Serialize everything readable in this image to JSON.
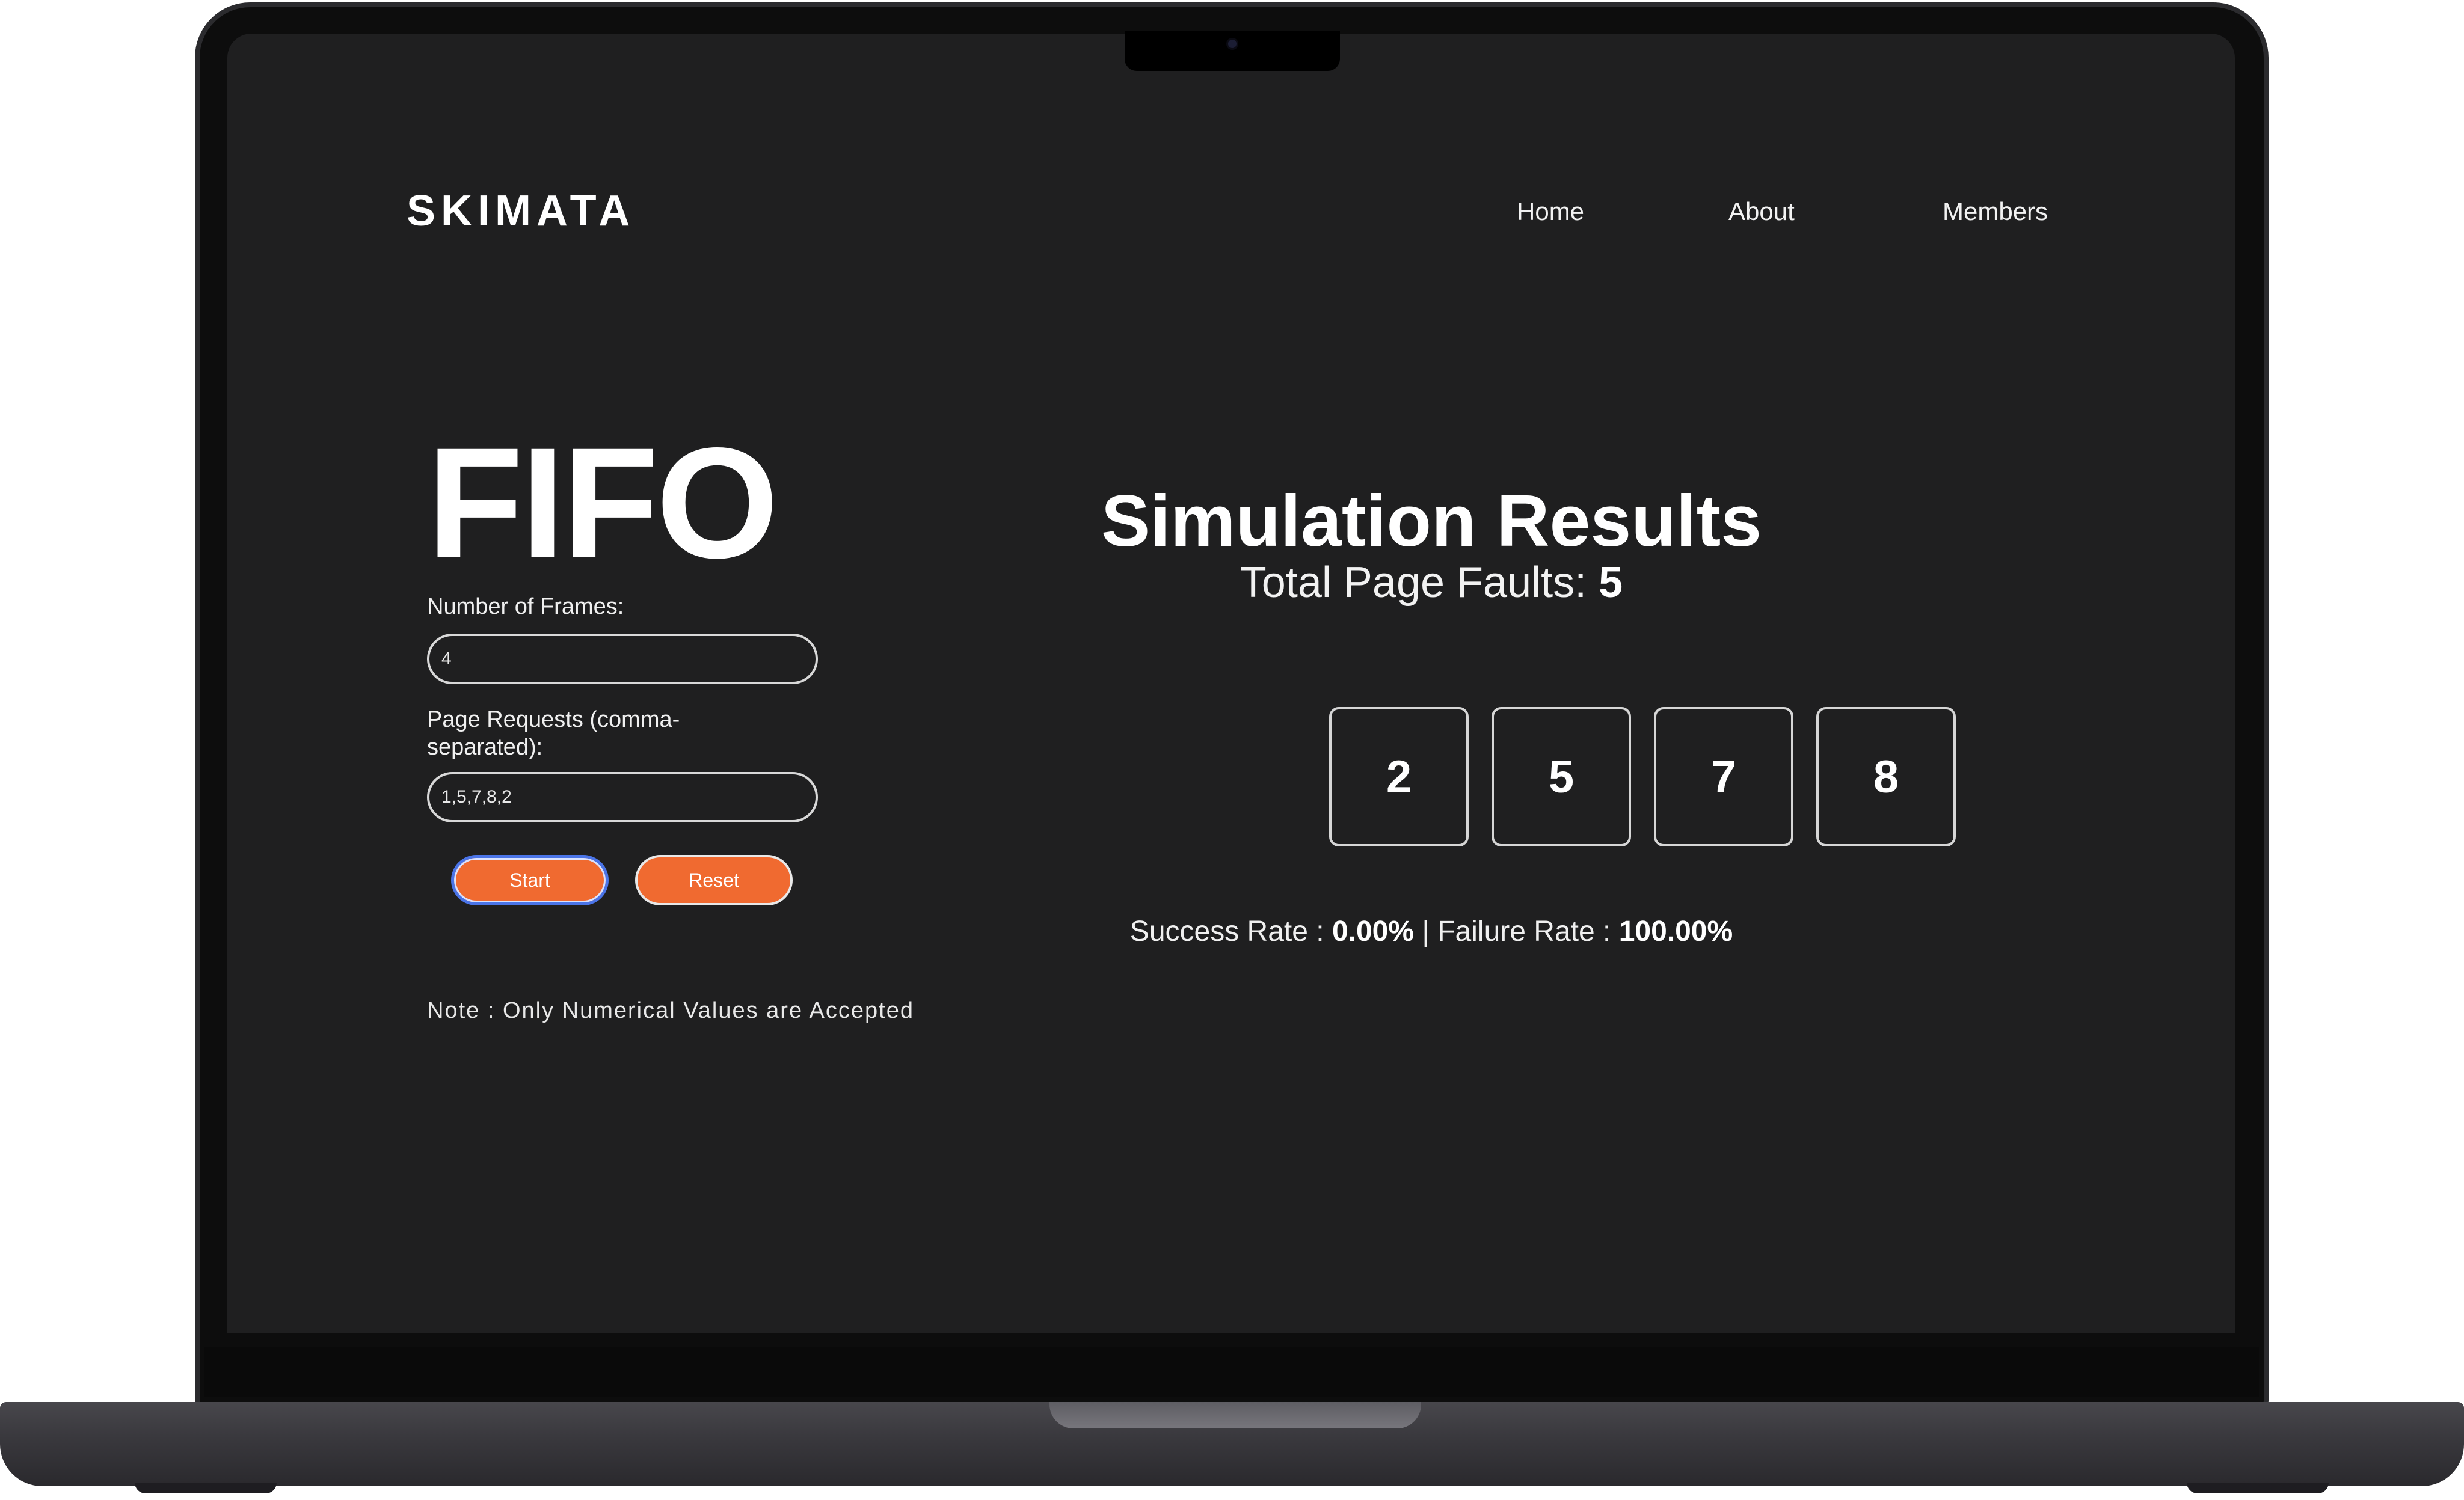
{
  "brand": "SKIMATA",
  "nav": {
    "home": "Home",
    "about": "About",
    "members": "Members"
  },
  "algorithm": {
    "title": "FIFO",
    "frames_label": "Number of Frames:",
    "frames_value": "4",
    "requests_label": "Page Requests (comma-separated):",
    "requests_value": "1,5,7,8,2",
    "start_label": "Start",
    "reset_label": "Reset",
    "note": "Note : Only Numerical Values are Accepted"
  },
  "results": {
    "title": "Simulation Results",
    "faults_label": "Total Page Faults:",
    "faults_value": "5",
    "frames": [
      "2",
      "5",
      "7",
      "8"
    ],
    "success_label": "Success Rate :",
    "success_value": "0.00%",
    "separator": "|",
    "failure_label": "Failure Rate :",
    "failure_value": "100.00%"
  },
  "colors": {
    "background": "#1f1f20",
    "accent": "#f06a30",
    "focus_ring": "#4a74e8"
  }
}
